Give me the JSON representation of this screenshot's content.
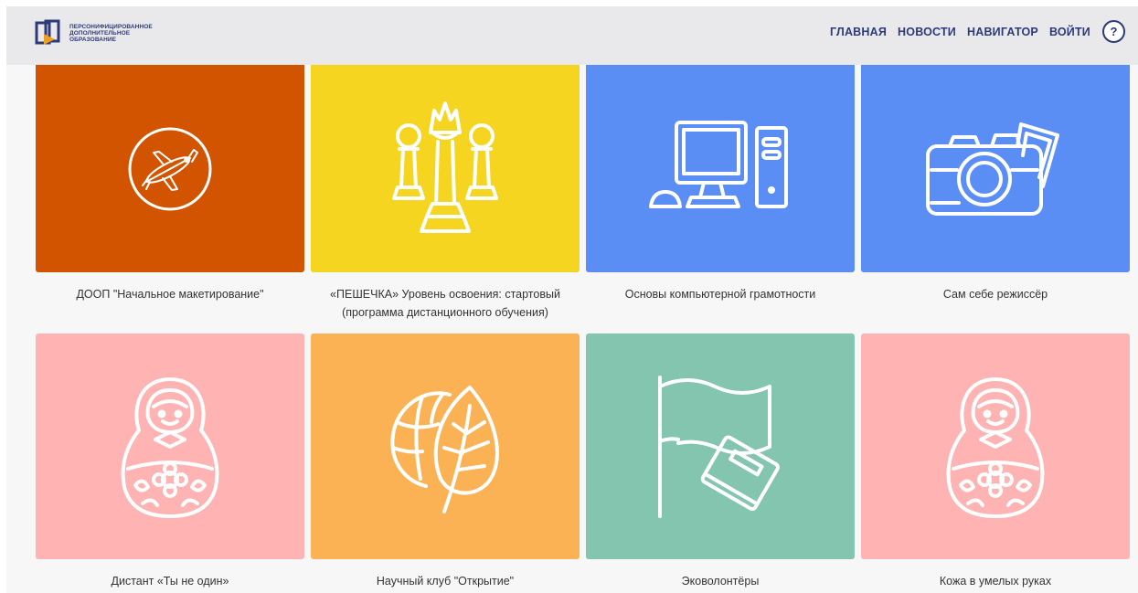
{
  "header": {
    "logo_lines": [
      "ПЕРСОНИФИЦИРОВАННОЕ",
      "ДОПОЛНИТЕЛЬНОЕ",
      "ОБРАЗОВАНИЕ"
    ],
    "nav": [
      "ГЛАВНАЯ",
      "НОВОСТИ",
      "НАВИГАТОР",
      "ВОЙТИ"
    ],
    "help_label": "?"
  },
  "cards": [
    {
      "title": "ДООП \"Начальное макетирование\"",
      "color": "#d35400",
      "icon": "airplane-icon"
    },
    {
      "title": "«ПЕШЕЧКА» Уровень освоения: стартовый (программа дистанционного обучения)",
      "color": "#f5d51f",
      "icon": "chess-icon"
    },
    {
      "title": "Основы компьютерной грамотности",
      "color": "#5b8ef5",
      "icon": "computer-icon"
    },
    {
      "title": "Сам себе режиссёр",
      "color": "#5b8ef5",
      "icon": "camera-icon"
    },
    {
      "title": "Дистант «Ты не один»",
      "color": "#ffb3b3",
      "icon": "matryoshka-icon"
    },
    {
      "title": "Научный клуб \"Открытие\"",
      "color": "#fbb254",
      "icon": "leaf-globe-icon"
    },
    {
      "title": "Эковолонтёры",
      "color": "#83c5ae",
      "icon": "flag-book-icon"
    },
    {
      "title": "Кожа в умелых руках",
      "color": "#ffb3b3",
      "icon": "matryoshka-icon"
    }
  ]
}
